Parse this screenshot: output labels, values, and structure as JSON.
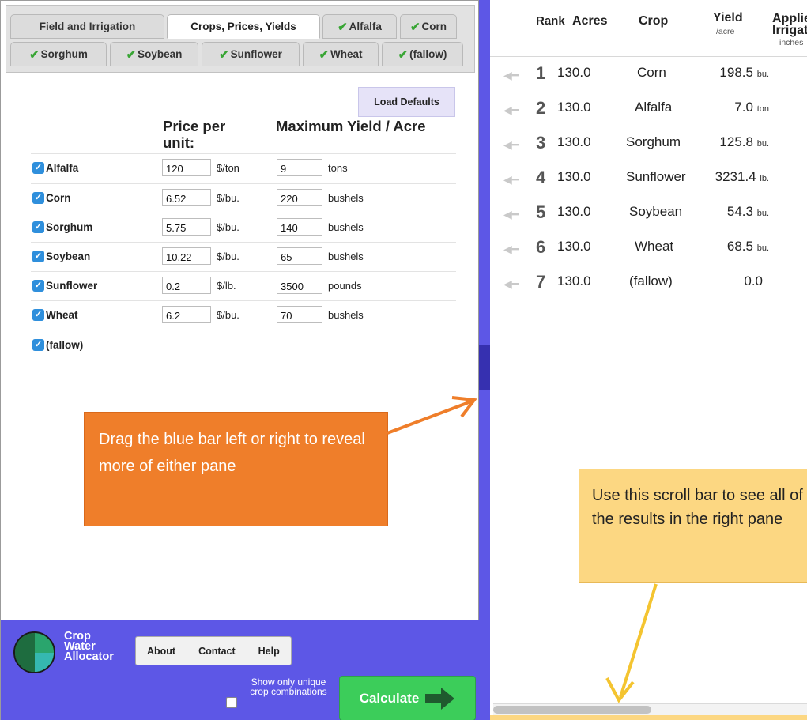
{
  "tabs_row1": [
    {
      "label": "Field and Irrigation",
      "checked": false,
      "active": false
    },
    {
      "label": "Crops, Prices, Yields",
      "checked": false,
      "active": true
    },
    {
      "label": "Alfalfa",
      "checked": true,
      "active": false
    },
    {
      "label": "Corn",
      "checked": true,
      "active": false
    }
  ],
  "tabs_row2": [
    {
      "label": "Sorghum",
      "checked": true
    },
    {
      "label": "Soybean",
      "checked": true
    },
    {
      "label": "Sunflower",
      "checked": true
    },
    {
      "label": "Wheat",
      "checked": true
    },
    {
      "label": "(fallow)",
      "checked": true
    }
  ],
  "check_glyph": "✔",
  "checkbox_glyph": "✓",
  "load_defaults_label": "Load Defaults",
  "columns": {
    "price_header": "Price per unit:",
    "yield_header": "Maximum Yield / Acre"
  },
  "crops": [
    {
      "name": "Alfalfa",
      "checked": true,
      "price": "120",
      "price_unit": "$/ton",
      "max_yield": "9",
      "yield_unit": "tons"
    },
    {
      "name": "Corn",
      "checked": true,
      "price": "6.52",
      "price_unit": "$/bu.",
      "max_yield": "220",
      "yield_unit": "bushels"
    },
    {
      "name": "Sorghum",
      "checked": true,
      "price": "5.75",
      "price_unit": "$/bu.",
      "max_yield": "140",
      "yield_unit": "bushels"
    },
    {
      "name": "Soybean",
      "checked": true,
      "price": "10.22",
      "price_unit": "$/bu.",
      "max_yield": "65",
      "yield_unit": "bushels"
    },
    {
      "name": "Sunflower",
      "checked": true,
      "price": "0.2",
      "price_unit": "$/lb.",
      "max_yield": "3500",
      "yield_unit": "pounds"
    },
    {
      "name": "Wheat",
      "checked": true,
      "price": "6.2",
      "price_unit": "$/bu.",
      "max_yield": "70",
      "yield_unit": "bushels"
    },
    {
      "name": "(fallow)",
      "checked": true
    }
  ],
  "callout_splitter": "Drag the blue bar left or right to reveal more of either pane",
  "callout_scroll": "Use this scroll bar to see all of the results in the right pane",
  "footer": {
    "app_name_lines": [
      "Crop",
      "Water",
      "Allocator"
    ],
    "nav": [
      "About",
      "Contact",
      "Help"
    ],
    "unique_label": "Show only unique crop combinations",
    "unique_checked": false,
    "calculate_label": "Calculate"
  },
  "results_header": {
    "rank": "Rank",
    "acres": "Acres",
    "crop": "Crop",
    "yield": "Yield",
    "yield_sub": "/acre",
    "applied": "Applied Irrigation",
    "applied_sub": "inches"
  },
  "results": [
    {
      "rank": "1",
      "acres": "130.0",
      "crop": "Corn",
      "yield": "198.5",
      "yield_unit": "bu."
    },
    {
      "rank": "2",
      "acres": "130.0",
      "crop": "Alfalfa",
      "yield": "7.0",
      "yield_unit": "ton"
    },
    {
      "rank": "3",
      "acres": "130.0",
      "crop": "Sorghum",
      "yield": "125.8",
      "yield_unit": "bu."
    },
    {
      "rank": "4",
      "acres": "130.0",
      "crop": "Sunflower",
      "yield": "3231.4",
      "yield_unit": "lb."
    },
    {
      "rank": "5",
      "acres": "130.0",
      "crop": "Soybean",
      "yield": "54.3",
      "yield_unit": "bu."
    },
    {
      "rank": "6",
      "acres": "130.0",
      "crop": "Wheat",
      "yield": "68.5",
      "yield_unit": "bu."
    },
    {
      "rank": "7",
      "acres": "130.0",
      "crop": "(fallow)",
      "yield": "0.0",
      "yield_unit": ""
    }
  ],
  "colors": {
    "accent_blue": "#5d57e6",
    "callout_orange": "#ef7e2a",
    "callout_yellow": "#fcd782",
    "arrow_yellow": "#f4c430",
    "calculate_green": "#3ccd5a",
    "check_green": "#38a534"
  },
  "icons": {
    "tab_check": "check-icon",
    "row_arrow": "left-arrow-icon",
    "calculate": "right-arrow-icon",
    "logo": "crop-water-logo-icon"
  }
}
